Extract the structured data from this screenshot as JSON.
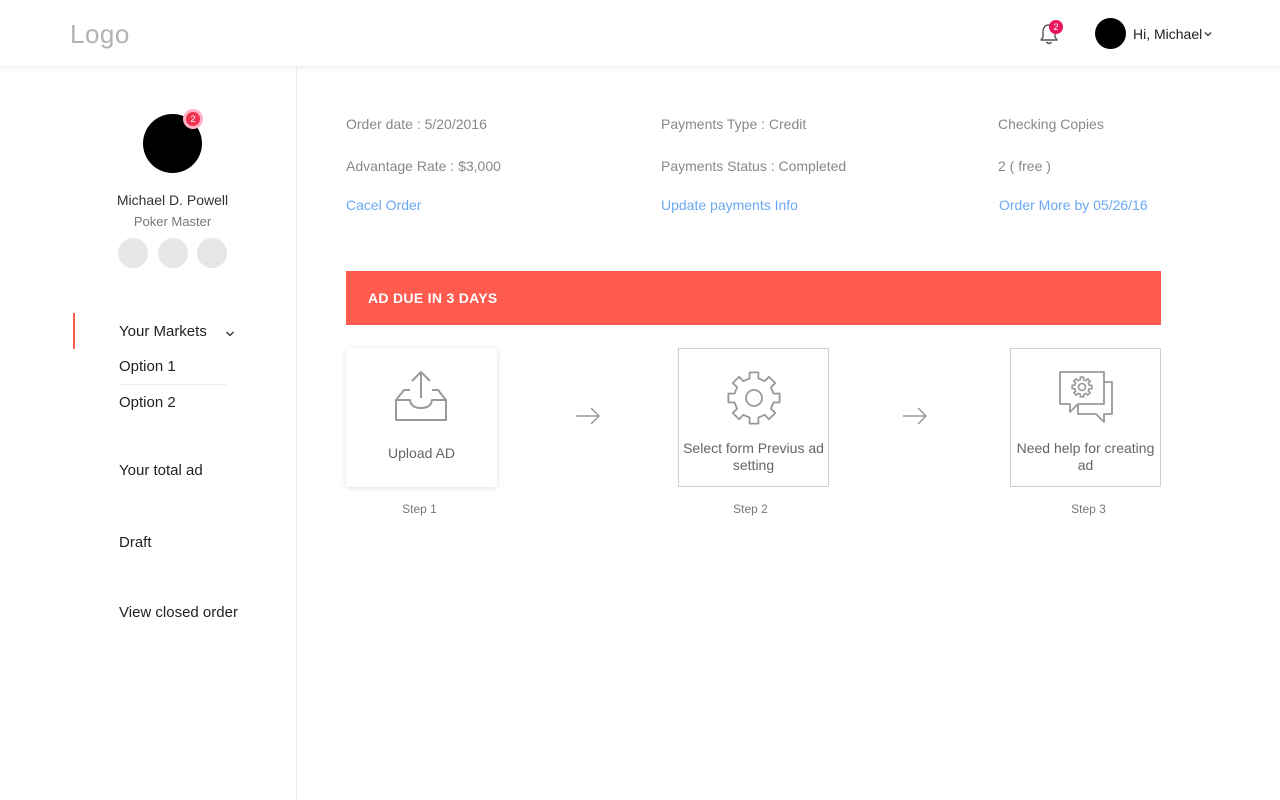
{
  "header": {
    "logo": "Logo",
    "notifications_count": "2",
    "greeting": "Hi, Michael"
  },
  "profile": {
    "name": "Michael D. Powell",
    "role": "Poker Master",
    "badge_count": "2"
  },
  "nav": {
    "your_markets": "Your Markets",
    "option1": "Option 1",
    "option2": "Option 2",
    "total_ad": "Your total ad",
    "draft": "Draft",
    "closed_order": "View closed order"
  },
  "order": {
    "order_date": "Order date : 5/20/2016",
    "advantage_rate": "Advantage Rate : $3,000",
    "cancel_link": "Cacel Order",
    "payments_type": "Payments Type : Credit",
    "payments_status": "Payments Status : Completed",
    "update_link": "Update payments Info",
    "checking_copies": "Checking Copies",
    "copies_value": "2 ( free )",
    "order_more_link": "Order More by 05/26/16"
  },
  "banner": {
    "text": "AD DUE IN 3 DAYS"
  },
  "steps": [
    {
      "label": "Upload AD",
      "caption": "Step 1",
      "icon": "upload-tray-icon"
    },
    {
      "label": "Select form Previus ad setting",
      "caption": "Step 2",
      "icon": "gear-icon"
    },
    {
      "label": "Need help for creating ad",
      "caption": "Step 3",
      "icon": "chat-gear-icon"
    }
  ],
  "colors": {
    "accent": "#ff5a4e",
    "link": "#6aa8f2",
    "badge": "#e8175d"
  }
}
